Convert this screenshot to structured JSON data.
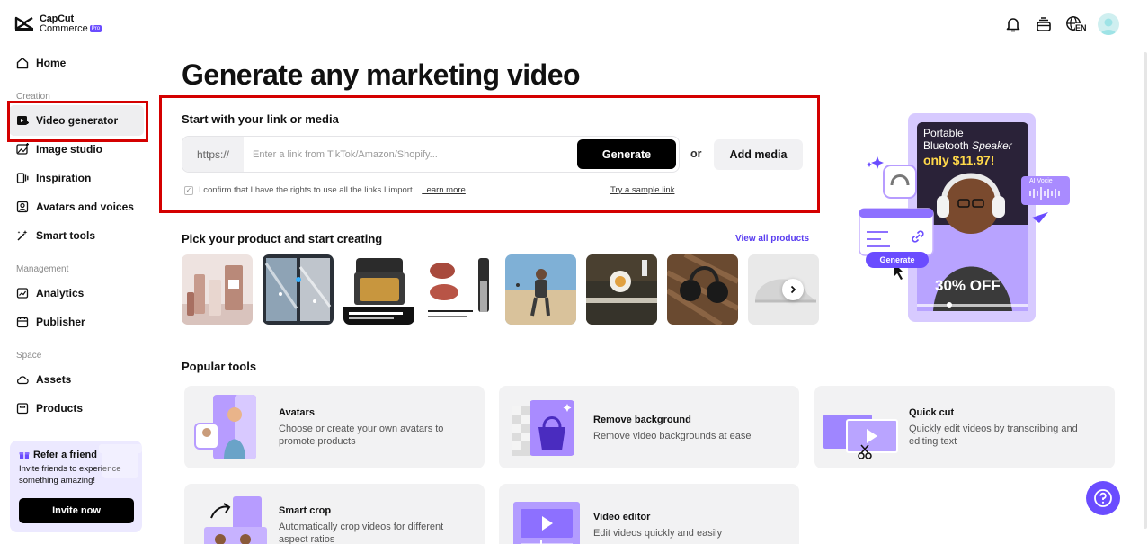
{
  "brand": {
    "line1": "CapCut",
    "line2": "Commerce",
    "badge": "Pro"
  },
  "sidebar": {
    "home": "Home",
    "sections": {
      "creation": "Creation",
      "management": "Management",
      "space": "Space"
    },
    "creation_items": [
      "Video generator",
      "Image studio",
      "Inspiration",
      "Avatars and voices",
      "Smart tools"
    ],
    "management_items": [
      "Analytics",
      "Publisher"
    ],
    "space_items": [
      "Assets",
      "Products"
    ],
    "active_item": "Video generator"
  },
  "refer": {
    "title": "Refer a friend",
    "text": "Invite friends to experience something amazing!",
    "button": "Invite now"
  },
  "header": {
    "language": "EN"
  },
  "main": {
    "title": "Generate any marketing video",
    "start_label": "Start with your link or media",
    "link_prefix": "https://",
    "link_placeholder": "Enter a link from TikTok/Amazon/Shopify...",
    "generate_label": "Generate",
    "or": "or",
    "add_media": "Add media",
    "confirm_text": "I confirm that I have the rights to use all the links I import.",
    "learn_more": "Learn more",
    "sample_link": "Try a sample link",
    "pick_label": "Pick your product and start creating",
    "view_all": "View all products",
    "popular_label": "Popular tools"
  },
  "tools": [
    {
      "title": "Avatars",
      "desc": "Choose or create your own avatars to promote products"
    },
    {
      "title": "Remove background",
      "desc": "Remove video backgrounds at ease"
    },
    {
      "title": "Quick cut",
      "desc": "Quickly edit videos by transcribing and editing text"
    },
    {
      "title": "Smart crop",
      "desc": "Automatically crop videos for different aspect ratios"
    },
    {
      "title": "Video editor",
      "desc": "Edit videos quickly and easily"
    }
  ],
  "hero": {
    "line1": "Portable",
    "line2": "Bluetooth",
    "line2b": "Speaker",
    "price": "only $11.97!",
    "discount": "30% OFF",
    "ai_voice": "AI Vocie",
    "generate": "Generate"
  },
  "colors": {
    "accent": "#6a4cff",
    "highlight": "#d40000",
    "hero_bg": "#c9b8ff"
  }
}
